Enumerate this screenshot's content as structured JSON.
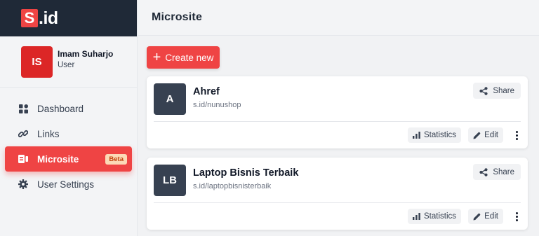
{
  "brand": {
    "logo_letter": "S",
    "logo_suffix": ".id",
    "accent": "#ef4444",
    "dark": "#1f2937"
  },
  "user": {
    "initials": "IS",
    "name": "Imam Suharjo",
    "role": "User"
  },
  "nav": [
    {
      "label": "Dashboard",
      "icon": "dashboard-icon",
      "active": false
    },
    {
      "label": "Links",
      "icon": "link-icon",
      "active": false
    },
    {
      "label": "Microsite",
      "icon": "microsite-icon",
      "active": true,
      "badge": "Beta"
    },
    {
      "label": "User Settings",
      "icon": "gear-icon",
      "active": false
    }
  ],
  "header": {
    "title": "Microsite"
  },
  "actions": {
    "create_label": "Create new",
    "create_icon": "plus-icon"
  },
  "cards": [
    {
      "initials": "A",
      "title": "Ahref",
      "url": "s.id/nunushop",
      "share_label": "Share",
      "statistics_label": "Statistics",
      "edit_label": "Edit"
    },
    {
      "initials": "LB",
      "title": "Laptop Bisnis Terbaik",
      "url": "s.id/laptopbisnisterbaik",
      "share_label": "Share",
      "statistics_label": "Statistics",
      "edit_label": "Edit"
    }
  ]
}
